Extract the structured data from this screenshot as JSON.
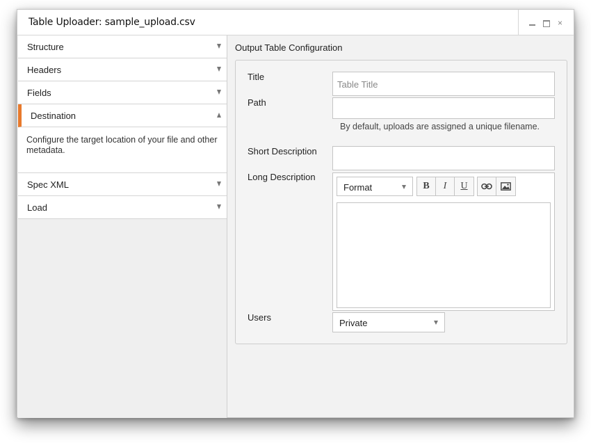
{
  "window": {
    "title": "Table Uploader: sample_upload.csv",
    "controls": {
      "minimize": "minimize-icon",
      "maximize": "maximize-icon",
      "close": "×"
    }
  },
  "sidebar": {
    "items": [
      {
        "label": "Structure",
        "expanded": false
      },
      {
        "label": "Headers",
        "expanded": false
      },
      {
        "label": "Fields",
        "expanded": false
      },
      {
        "label": "Destination",
        "expanded": true,
        "description": "Configure the target location of your file and other metadata."
      },
      {
        "label": "Spec XML",
        "expanded": false
      },
      {
        "label": "Load",
        "expanded": false
      }
    ],
    "accent_color": "#e87a2c"
  },
  "main": {
    "section_title": "Output Table Configuration",
    "fields": {
      "title": {
        "label": "Title",
        "placeholder": "Table Title",
        "value": ""
      },
      "path": {
        "label": "Path",
        "value": "",
        "hint": "By default, uploads are assigned a unique filename."
      },
      "short_description": {
        "label": "Short Description",
        "value": ""
      },
      "long_description": {
        "label": "Long Description",
        "format_select": "Format",
        "toolbar": {
          "bold": "B",
          "italic": "I",
          "underline": "U",
          "link": "link-icon",
          "image": "image-icon"
        },
        "value": ""
      },
      "users": {
        "label": "Users",
        "value": "Private"
      }
    }
  }
}
